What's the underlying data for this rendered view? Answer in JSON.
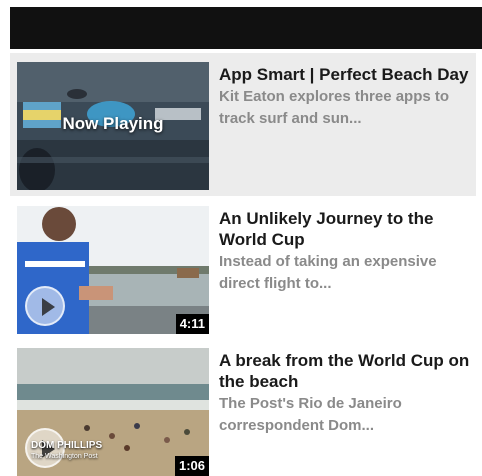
{
  "colors": {
    "header": "#111111",
    "active_bg": "#ececec",
    "title": "#1a1a1a",
    "description": "#8a8a8a"
  },
  "videos": [
    {
      "title": "App Smart | Perfect Beach Day",
      "description": "Kit Eaton explores three apps to track surf and sun...",
      "overlay": "Now Playing",
      "active": true
    },
    {
      "title": "An Unlikely Journey to the World Cup",
      "description": "Instead of taking an expensive direct flight to...",
      "duration": "4:11"
    },
    {
      "title": "A break from the World Cup on the beach",
      "description": "The Post's Rio de Janeiro correspondent Dom...",
      "duration": "1:06",
      "thumb_caption": "DOM PHILLIPS",
      "thumb_subcaption": "The Washington Post"
    }
  ]
}
